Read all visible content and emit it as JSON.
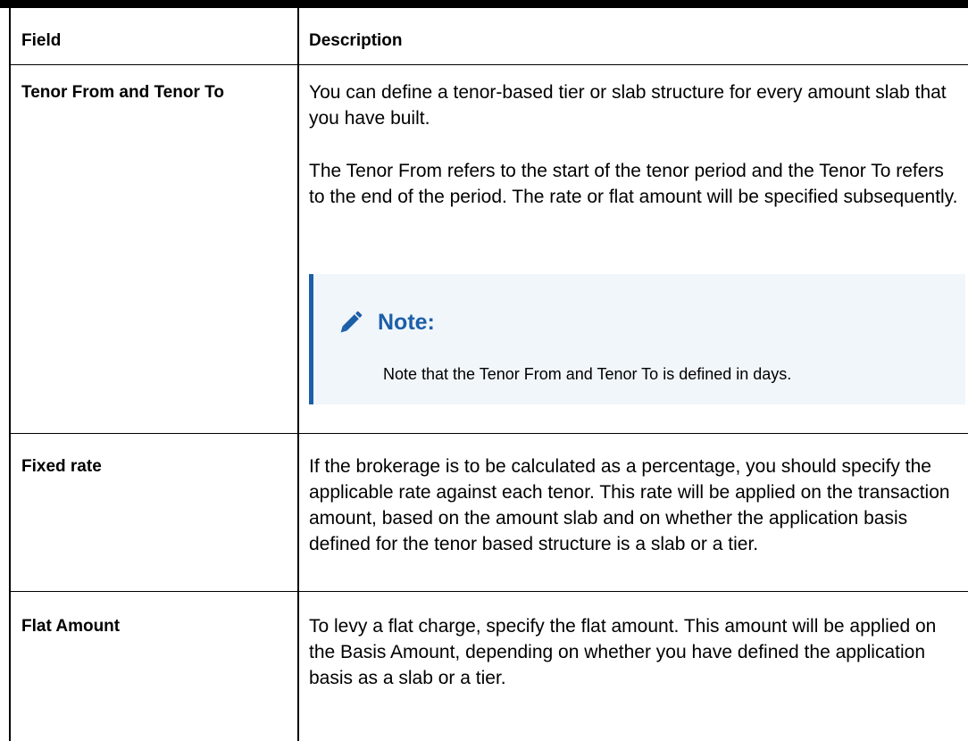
{
  "table": {
    "headers": {
      "field": "Field",
      "description": "Description"
    },
    "rows": [
      {
        "field": "Tenor From and Tenor To",
        "paragraphs": [
          "You can define a tenor-based tier or slab structure for every amount slab that you have built.",
          "The Tenor From refers to the start of the tenor period and the Tenor To refers to the end of the period. The rate or flat amount will be specified subsequently."
        ],
        "note": {
          "icon": "pencil-icon",
          "title": "Note:",
          "text": "Note that the Tenor From and Tenor To is defined in days."
        }
      },
      {
        "field": "Fixed rate",
        "paragraphs": [
          "If the brokerage is to be calculated as a percentage, you should specify the applicable rate against each tenor. This rate will be applied on the transaction amount, based on the amount slab and on whether the application basis defined for the tenor based structure is a slab or a tier."
        ]
      },
      {
        "field": "Flat Amount",
        "paragraphs": [
          "To levy a flat charge, specify the flat amount. This amount will be applied on the Basis Amount, depending on whether you have defined the application basis as a slab or a tier."
        ]
      }
    ]
  },
  "colors": {
    "note_accent": "#1c5fa8",
    "note_background": "#f1f6fb",
    "rule": "#000000"
  }
}
